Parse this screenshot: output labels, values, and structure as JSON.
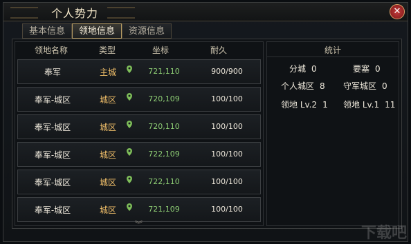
{
  "window": {
    "title": "个人势力"
  },
  "tabs": [
    {
      "label": "基本信息",
      "active": false
    },
    {
      "label": "领地信息",
      "active": true
    },
    {
      "label": "资源信息",
      "active": false
    }
  ],
  "table": {
    "headers": {
      "name": "领地名称",
      "type": "类型",
      "coord": "坐标",
      "durability": "耐久"
    },
    "rows": [
      {
        "name": "奉军",
        "type": "主城",
        "coord": "721,110",
        "durability": "900/900"
      },
      {
        "name": "奉军-城区",
        "type": "城区",
        "coord": "720,109",
        "durability": "100/100"
      },
      {
        "name": "奉军-城区",
        "type": "城区",
        "coord": "720,110",
        "durability": "100/100"
      },
      {
        "name": "奉军-城区",
        "type": "城区",
        "coord": "722,109",
        "durability": "100/100"
      },
      {
        "name": "奉军-城区",
        "type": "城区",
        "coord": "722,110",
        "durability": "100/100"
      },
      {
        "name": "奉军-城区",
        "type": "城区",
        "coord": "721,109",
        "durability": "100/100"
      }
    ],
    "scroll_hint": "︾"
  },
  "stats": {
    "title": "统计",
    "items": [
      {
        "label": "分城",
        "value": "0"
      },
      {
        "label": "要塞",
        "value": "0"
      },
      {
        "label": "个人城区",
        "value": "8"
      },
      {
        "label": "守军城区",
        "value": "0"
      },
      {
        "label": "领地 Lv.2",
        "value": "1"
      },
      {
        "label": "领地 Lv.1",
        "value": "11"
      }
    ]
  },
  "close_label": "✕",
  "watermark": "下载吧"
}
